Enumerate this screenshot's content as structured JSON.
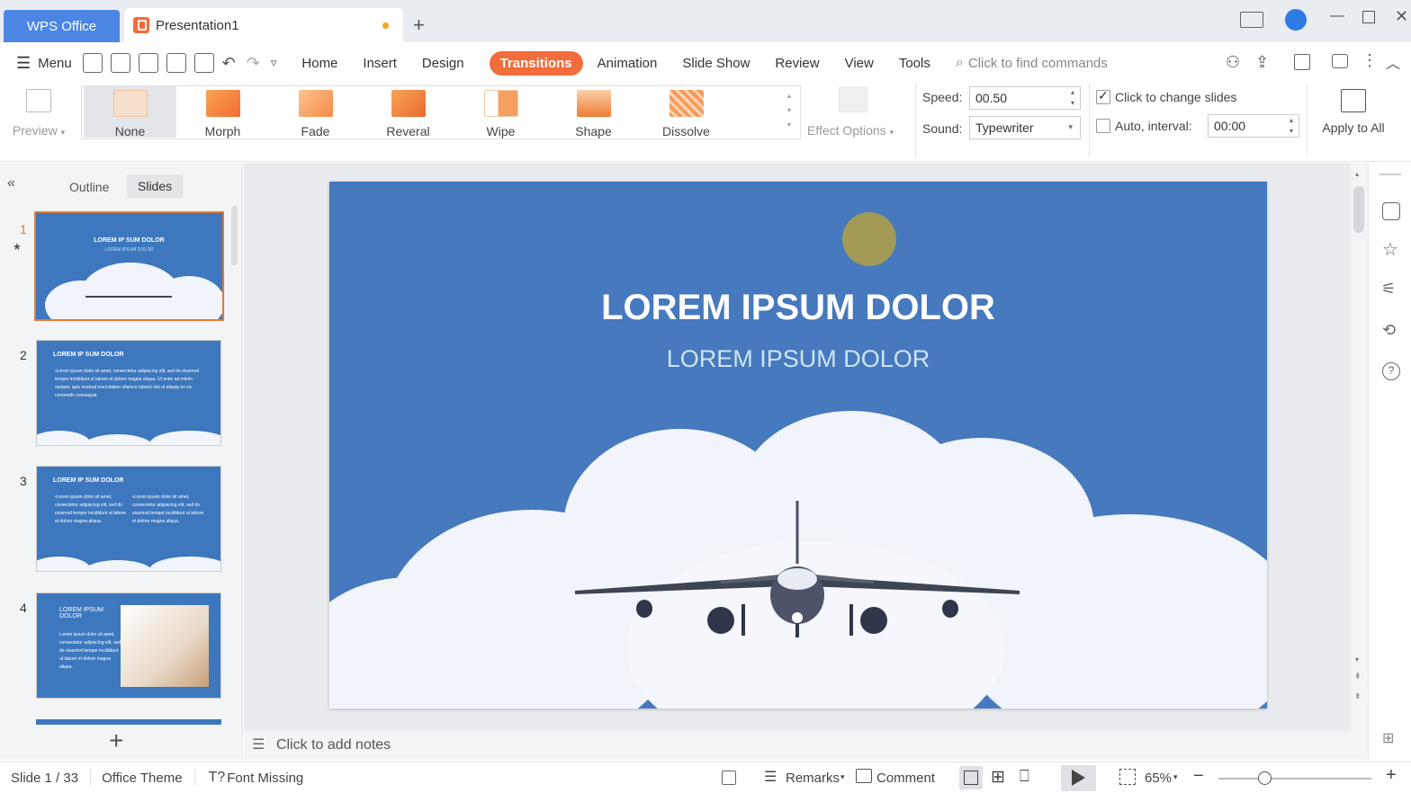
{
  "tabs": {
    "home": "WPS Office",
    "doc": "Presentation1"
  },
  "menu": {
    "menu_label": "Menu",
    "items": [
      "Home",
      "Insert",
      "Design",
      "Transitions",
      "Animation",
      "Slide Show",
      "Review",
      "View",
      "Tools"
    ],
    "search_placeholder": "Click to find commands"
  },
  "ribbon": {
    "preview": "Preview",
    "transitions": [
      "None",
      "Morph",
      "Fade",
      "Reveral",
      "Wipe",
      "Shape",
      "Dissolve"
    ],
    "effect_options": "Effect Options",
    "speed_label": "Speed:",
    "speed_value": "00.50",
    "sound_label": "Sound:",
    "sound_value": "Typewriter",
    "click_change": "Click to change slides",
    "auto_interval": "Auto, interval:",
    "interval_value": "00:00",
    "apply_all": "Apply to All"
  },
  "leftpane": {
    "tab_outline": "Outline",
    "tab_slides": "Slides",
    "slides": [
      {
        "num": "1",
        "title": "LOREM IP SUM DOLOR",
        "sub": "LOREM IPSUM DOLOR"
      },
      {
        "num": "2",
        "title": "LOREM IP SUM DOLOR",
        "body": "•Lorem ipsum dolor sit amet, consectetur adipiscing elit, sed do eiusmod tempor incididunt ut labore et dolore magna aliqua. Ut enim ad minim veniam, quis nostrud exercitation ullamco laboris nisi ut aliquip ex ea commodo consequat."
      },
      {
        "num": "3",
        "title": "LOREM IP SUM DOLOR",
        "body": "•Lorem ipsum dolor sit amet, consectetur adipiscing elit, sed do eiusmod tempor incididunt ut labore et dolore magna aliqua.",
        "body2": "•Lorem ipsum dolor sit amet, consectetur adipiscing elit, sed do eiusmod tempor incididunt ut labore et dolore magna aliqua."
      },
      {
        "num": "4",
        "title": "LOREM IPSUM DOLOR",
        "body": "Lorem ipsum dolor sit amet, consectetur adipiscing elit, sed do eiusmod tempor incididunt ut labore et dolore magna aliqua."
      }
    ]
  },
  "slide": {
    "title": "LOREM IPSUM DOLOR",
    "subtitle": "LOREM IPSUM DOLOR"
  },
  "notes": "Click to add notes",
  "status": {
    "slide_counter": "Slide 1 / 33",
    "theme": "Office Theme",
    "font_missing": "Font Missing",
    "remarks": "Remarks",
    "comment": "Comment",
    "zoom": "65%"
  },
  "colors": {
    "accent": "#f26c3c",
    "brand": "#4b86e5",
    "slide_bg": "#4679bd"
  }
}
